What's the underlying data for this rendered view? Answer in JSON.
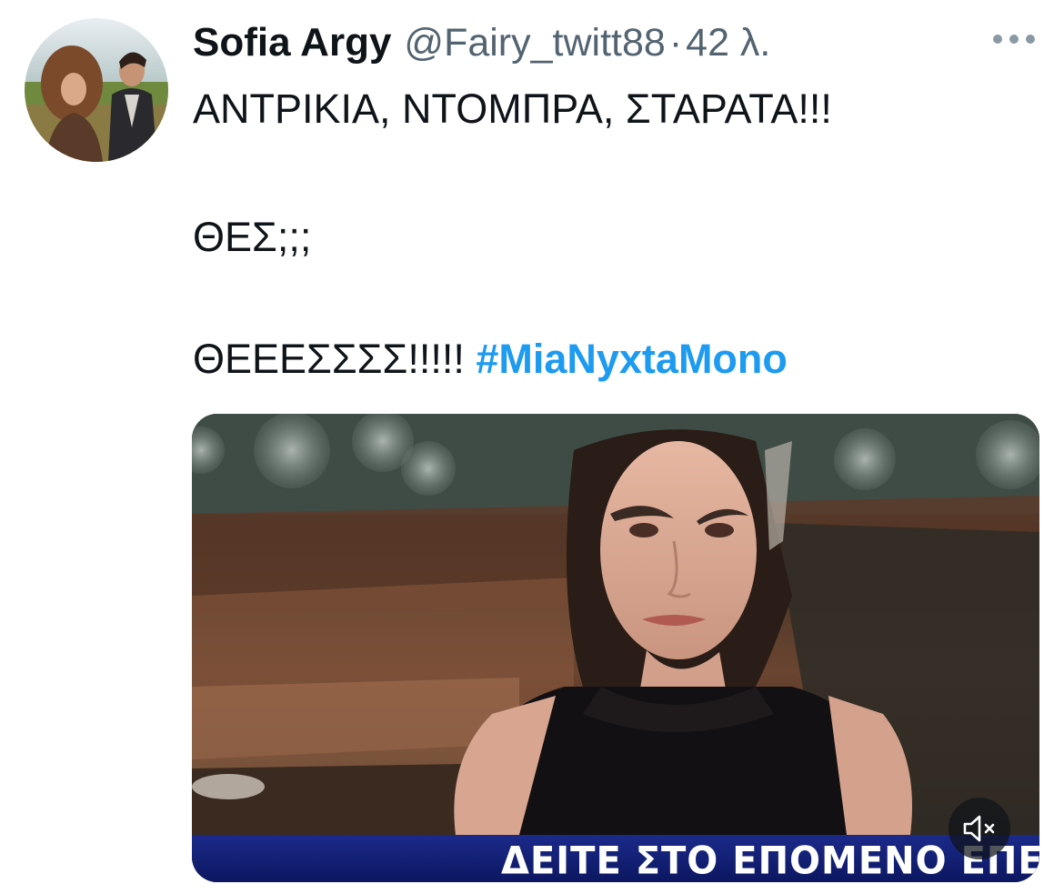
{
  "tweet": {
    "author": {
      "display_name": "Sofia Argy",
      "handle": "@Fairy_twitt88",
      "avatar_icon": "profile-photo"
    },
    "separator": "·",
    "time": "42 λ.",
    "more_icon": "more-horizontal-icon",
    "text_lines": [
      "ΑΝΤΡΙΚΙΑ, ΝΤΟΜΠΡΑ, ΣΤΑΡΑΤΑ!!!",
      "ΘΕΣ;;;",
      "ΘΕΕΕΣΣΣΣ!!!!!"
    ],
    "hashtag": "#MiaNyxtaMono",
    "hashtag_color": "#1d9bf0",
    "media": {
      "type": "video",
      "caption_overlay": "ΔΕΙΤΕ ΣΤΟ ΕΠΟΜΕΝΟ ΕΠΕΙΣΟΔ",
      "mute_icon": "volume-muted-icon"
    }
  },
  "colors": {
    "primary_text": "#0f1419",
    "secondary_text": "#536471",
    "accent": "#1d9bf0"
  }
}
